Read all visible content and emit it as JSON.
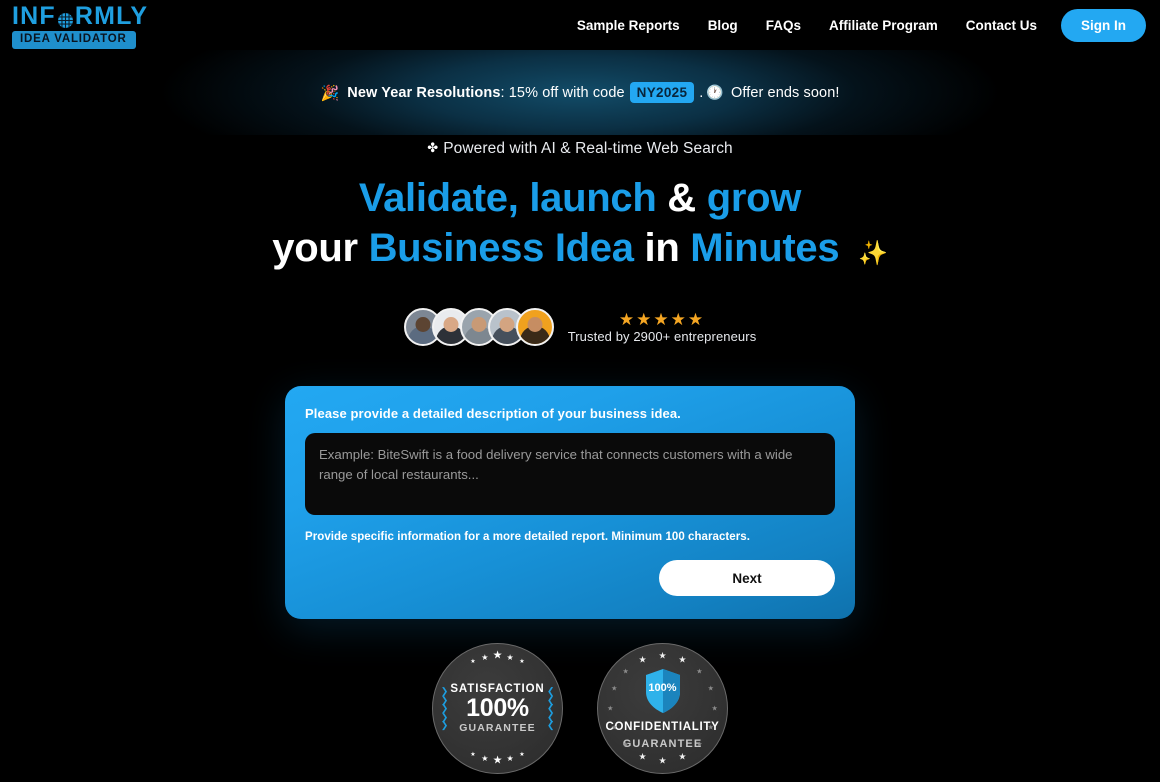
{
  "brand": {
    "logo_part1": "INF",
    "logo_globe_icon": "globe-icon",
    "logo_part2": "RMLY",
    "tagline_badge": "IDEA VALIDATOR",
    "accent_blue": "#23a8f2",
    "logo_blue": "#1f9fe0"
  },
  "nav": {
    "items": [
      {
        "label": "Sample Reports"
      },
      {
        "label": "Blog"
      },
      {
        "label": "FAQs"
      },
      {
        "label": "Affiliate Program"
      },
      {
        "label": "Contact Us"
      }
    ],
    "signin_label": "Sign In"
  },
  "promo": {
    "emoji": "🎉",
    "bold_text": "New Year Resolutions",
    "text_after_bold": ": 15% off with code ",
    "code": "NY2025",
    "period": ".",
    "clock_emoji": "🕐",
    "tail_text": "Offer ends soon!"
  },
  "hero": {
    "kicker_icon": "sparkle-icon",
    "kicker": "Powered with AI & Real-time Web Search",
    "line1_word1": "Validate, launch",
    "line1_word2": "&",
    "line1_word3": "grow",
    "line2_word1": "your",
    "line2_word2": "Business Idea",
    "line2_word3": "in",
    "line2_word4": "Minutes",
    "sparkle_emoji": "✨",
    "title_blue": "#1a9de8"
  },
  "social_proof": {
    "stars": "★★★★★",
    "star_count": 5,
    "star_color": "#f5a623",
    "trusted_text": "Trusted by 2900+ entrepreneurs",
    "avatar_count": 5
  },
  "form": {
    "label": "Please provide a detailed description of your business idea.",
    "textarea_value": "",
    "textarea_placeholder": "Example: BiteSwift is a food delivery service that connects customers with a wide range of local restaurants...",
    "hint": "Provide specific information for a more detailed report. Minimum 100 characters.",
    "next_label": "Next"
  },
  "badges": [
    {
      "id": "satisfaction-guarantee",
      "top_text": "SATISFACTION",
      "big_text": "100%",
      "bottom_text": "GUARANTEE"
    },
    {
      "id": "confidentiality-guarantee",
      "shield_text": "100%",
      "top_text": "CONFIDENTIALITY",
      "bottom_text": "GUARANTEE"
    }
  ]
}
